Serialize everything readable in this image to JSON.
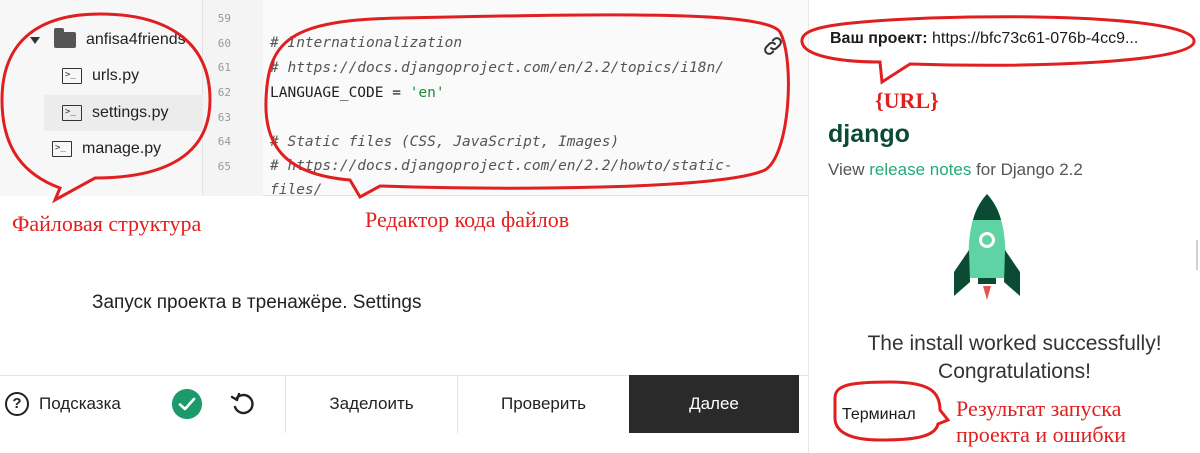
{
  "file_tree": {
    "folder": "anfisa4friends",
    "files": [
      "urls.py",
      "settings.py",
      "manage.py"
    ],
    "selected": "settings.py"
  },
  "editor": {
    "line_numbers": [
      "59",
      "60",
      "61",
      "62",
      "63",
      "64",
      "65"
    ],
    "lines": [
      "# Internationalization",
      "# https://docs.djangoproject.com/en/2.2/topics/i18n/",
      "LANGUAGE_CODE = ",
      "'en'",
      "# Static files (CSS, JavaScript, Images)",
      "# https://docs.djangoproject.com/en/2.2/howto/static-",
      "files/"
    ]
  },
  "task_title": "Запуск проекта в тренажёре. Settings",
  "bottom_bar": {
    "hint": "Подсказка",
    "deploy": "Заделоить",
    "check": "Проверить",
    "next": "Далее"
  },
  "right_panel": {
    "project_label": "Ваш проект:",
    "project_url": "https://bfc73c61-076b-4cc9...",
    "logo": "django",
    "release_prefix": "View ",
    "release_link": "release notes",
    "release_suffix": " for Django 2.2",
    "install_message": "The install worked successfully! Congratulations!",
    "terminal": "Терминал"
  },
  "annotations": {
    "files": "Файловая структура",
    "editor": "Редактор кода файлов",
    "url": "{URL}",
    "result_line1": "Результат запуска",
    "result_line2": "проекта и ошибки"
  },
  "colors": {
    "annotation": "#e02020",
    "django_green": "#0c4b33",
    "link_green": "#20aa76",
    "success_check": "#1d9a6c",
    "next_button": "#2a2a2a"
  }
}
